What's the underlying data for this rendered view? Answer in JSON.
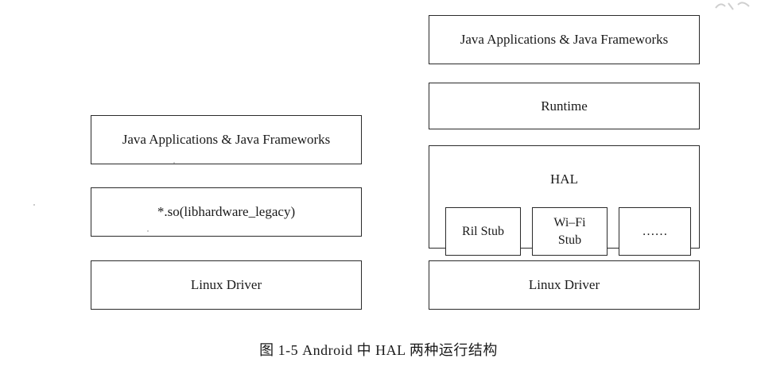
{
  "left_stack": {
    "java_layer": "Java Applications & Java Frameworks",
    "so_layer": "*.so(libhardware_legacy)",
    "driver_layer": "Linux Driver"
  },
  "right_stack": {
    "java_layer": "Java Applications & Java Frameworks",
    "runtime_layer": "Runtime",
    "hal_label": "HAL",
    "stubs": [
      "Ril Stub",
      "Wi–Fi Stub",
      "……"
    ],
    "driver_layer": "Linux Driver"
  },
  "caption": "图 1-5   Android 中 HAL 两种运行结构"
}
